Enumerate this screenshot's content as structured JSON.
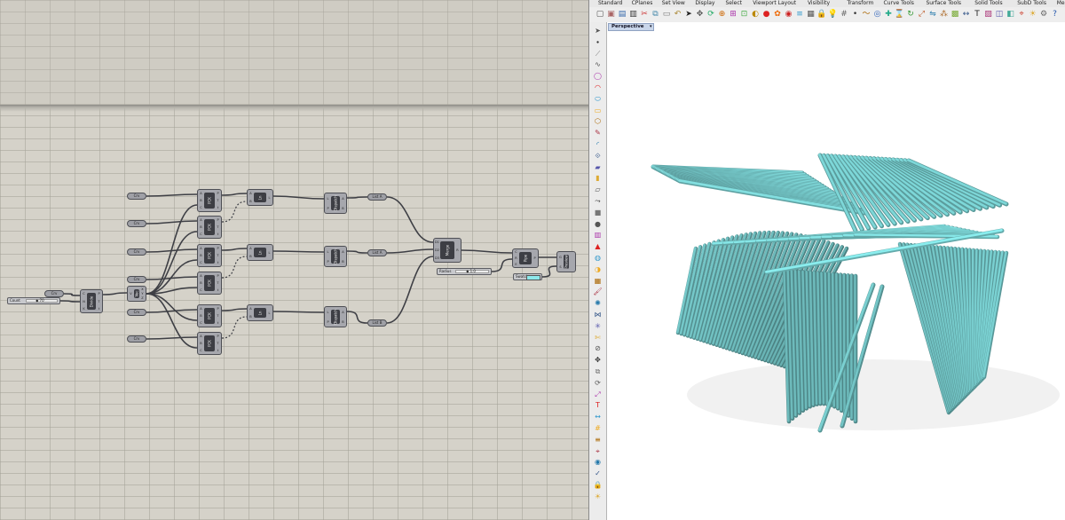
{
  "grasshopper": {
    "nodes": [
      {
        "id": "divide",
        "label": "Divide",
        "inputs": [
          "C",
          "N",
          "K"
        ],
        "outputs": [
          "P",
          "T",
          "t"
        ]
      },
      {
        "id": "vec",
        "label": "Vec",
        "inputs": [
          "V"
        ],
        "outputs": [
          "X",
          "Y",
          "Z"
        ]
      },
      {
        "id": "pck1",
        "label": "PCK",
        "inputs": [
          "A",
          "B",
          "C"
        ],
        "outputs": [
          "P",
          "T",
          "t"
        ]
      },
      {
        "id": "pck2",
        "label": "PCK",
        "inputs": [
          "A",
          "B",
          "C"
        ],
        "outputs": [
          "P",
          "T",
          "t"
        ]
      },
      {
        "id": "pck3",
        "label": "PCK",
        "inputs": [
          "A",
          "B",
          "C"
        ],
        "outputs": [
          "P",
          "T",
          "t"
        ]
      },
      {
        "id": "pck4",
        "label": "PCK",
        "inputs": [
          "A",
          "B",
          "C"
        ],
        "outputs": [
          "P",
          "T",
          "t"
        ]
      },
      {
        "id": "pck5",
        "label": "PCK",
        "inputs": [
          "A",
          "B",
          "C"
        ],
        "outputs": [
          "P",
          "T",
          "t"
        ]
      },
      {
        "id": "pck6",
        "label": "PCK",
        "inputs": [
          "A",
          "B",
          "C"
        ],
        "outputs": [
          "P",
          "T",
          "t"
        ]
      },
      {
        "id": "ln1",
        "label": "Ln",
        "inputs": [
          "A",
          "B"
        ],
        "outputs": [
          "L"
        ]
      },
      {
        "id": "ln2",
        "label": "Ln",
        "inputs": [
          "A",
          "B"
        ],
        "outputs": [
          "L"
        ]
      },
      {
        "id": "ln3",
        "label": "Ln",
        "inputs": [
          "A",
          "B"
        ],
        "outputs": [
          "L"
        ]
      },
      {
        "id": "dispatch1",
        "label": "Dispatch",
        "inputs": [
          "L",
          "P"
        ],
        "outputs": [
          "A",
          "B"
        ]
      },
      {
        "id": "dispatch2",
        "label": "Dispatch",
        "inputs": [
          "L",
          "P"
        ],
        "outputs": [
          "A",
          "B"
        ]
      },
      {
        "id": "dispatch3",
        "label": "Dispatch",
        "inputs": [
          "L",
          "P"
        ],
        "outputs": [
          "A",
          "B"
        ]
      },
      {
        "id": "merge",
        "label": "Merge",
        "inputs": [
          "D1",
          "D2",
          "D3"
        ],
        "outputs": [
          "R"
        ]
      },
      {
        "id": "pipe",
        "label": "Pipe",
        "inputs": [
          "C",
          "R",
          "E"
        ],
        "outputs": [
          "P"
        ]
      },
      {
        "id": "preview",
        "label": "Preview",
        "inputs": [
          "G",
          "S"
        ],
        "outputs": []
      }
    ],
    "crv_param_label": "Crv",
    "list_labels": [
      "List A",
      "List A",
      "List B"
    ],
    "count_slider": {
      "label": "Count",
      "value": "70"
    },
    "radius_slider": {
      "label": "Radius",
      "value": "1.0"
    },
    "swatch": {
      "label": "Swatch",
      "color": "#8de8ea"
    }
  },
  "rhino": {
    "tabs": [
      "Standard",
      "CPlanes",
      "Set View",
      "Display",
      "Select",
      "Viewport Layout",
      "Visibility",
      "Transform",
      "Curve Tools",
      "Surface Tools",
      "Solid Tools",
      "SubD Tools",
      "Mesh Tools"
    ],
    "viewport_title": "Perspective",
    "toolbar_icons": [
      "new-file-icon",
      "open-file-icon",
      "save-icon",
      "print-icon",
      "cut-icon",
      "copy-icon",
      "paste-icon",
      "undo-icon",
      "select-icon",
      "pan-icon",
      "rotate-view-icon",
      "zoom-icon",
      "zoom-window-icon",
      "zoom-extents-icon",
      "display-mode-icon",
      "shaded-icon",
      "color-wheel-icon",
      "render-icon",
      "layer-icon",
      "properties-icon",
      "lock-icon",
      "light-bulb-icon",
      "grid-icon",
      "point-icon",
      "curve-icon",
      "osnap-icon",
      "gumball-icon",
      "history-icon",
      "rotate-icon",
      "scale-icon",
      "mirror-icon",
      "array-icon",
      "block-icon",
      "dimension-icon",
      "text-icon",
      "hatch-icon",
      "cplane-icon",
      "named-view-icon",
      "analyze-icon",
      "render-settings-icon",
      "options-icon",
      "help-icon"
    ],
    "sidebar_icons": [
      "select-arrow-icon",
      "point-icon",
      "polyline-icon",
      "curve-icon",
      "circle-icon",
      "arc-icon",
      "ellipse-icon",
      "rectangle-icon",
      "polygon-icon",
      "freeform-icon",
      "fillet-icon",
      "offset-icon",
      "surface-icon",
      "extrude-icon",
      "loft-icon",
      "sweep-icon",
      "box-icon",
      "sphere-icon",
      "cylinder-icon",
      "cone-icon",
      "torus-icon",
      "boolean-icon",
      "mesh-icon",
      "paint-icon",
      "spray-icon",
      "join-icon",
      "explode-icon",
      "trim-icon",
      "split-icon",
      "move-icon",
      "copy-icon",
      "rotate-icon",
      "scale-icon",
      "text-icon",
      "dimension-icon",
      "grid-icon",
      "layer-icon",
      "analyze-icon",
      "render-icon",
      "check-icon",
      "lock-icon",
      "light-icon"
    ],
    "model_color": "#80dbdc"
  }
}
